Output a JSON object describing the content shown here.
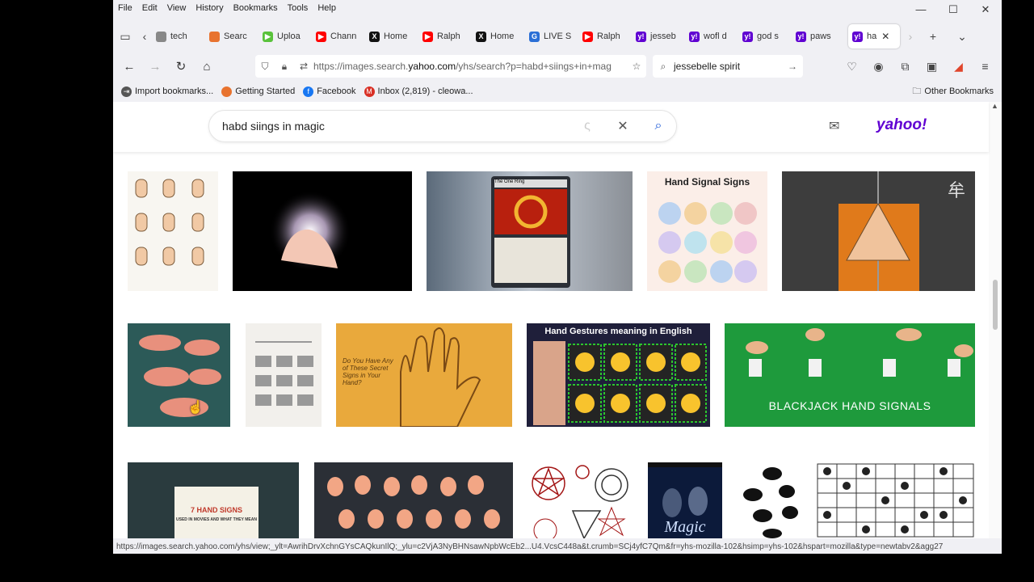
{
  "menubar": {
    "items": [
      "File",
      "Edit",
      "View",
      "History",
      "Bookmarks",
      "Tools",
      "Help"
    ]
  },
  "window_controls": {
    "minimize": "—",
    "maximize": "☐",
    "close": "✕"
  },
  "tabs": [
    {
      "label": "tech",
      "fav": "",
      "color": "#888888"
    },
    {
      "label": "Searc",
      "fav": "",
      "color": "#e8732f"
    },
    {
      "label": "Uploa",
      "fav": "▶",
      "color": "#59c23b"
    },
    {
      "label": "Chann",
      "fav": "▶",
      "color": "#ff0000"
    },
    {
      "label": "Home",
      "fav": "X",
      "color": "#111111"
    },
    {
      "label": "Ralph",
      "fav": "▶",
      "color": "#ff0000"
    },
    {
      "label": "Home",
      "fav": "X",
      "color": "#111111"
    },
    {
      "label": "LIVE S",
      "fav": "G",
      "color": "#2b6fd6"
    },
    {
      "label": "Ralph",
      "fav": "▶",
      "color": "#ff0000"
    },
    {
      "label": "jesseb",
      "fav": "y!",
      "color": "#6001d2"
    },
    {
      "label": "wofl d",
      "fav": "y!",
      "color": "#6001d2"
    },
    {
      "label": "god s",
      "fav": "y!",
      "color": "#6001d2"
    },
    {
      "label": "paws",
      "fav": "y!",
      "color": "#6001d2"
    }
  ],
  "active_tab": {
    "label": "ha",
    "fav": "y!",
    "color": "#6001d2"
  },
  "nav": {
    "url_prefix": "https://images.search.",
    "url_domain": "yahoo.com",
    "url_rest": "/yhs/search?p=habd+siings+in+mag",
    "search_value": "jessebelle spirit"
  },
  "bookmarks": [
    {
      "label": "Import bookmarks...",
      "color": "#555555",
      "fav": "⇥"
    },
    {
      "label": "Getting Started",
      "color": "#e8732f",
      "fav": ""
    },
    {
      "label": "Facebook",
      "color": "#1877f2",
      "fav": "f"
    },
    {
      "label": "Inbox (2,819) - cleowa...",
      "color": "#d93025",
      "fav": "M"
    }
  ],
  "other_bookmarks": "Other Bookmarks",
  "page": {
    "query": "habd siings in magic",
    "brand": "yahoo!",
    "brand_color": "#6001d2"
  },
  "images": {
    "hand_signal_title": "Hand Signal Signs",
    "gestures_title": "Hand Gestures meaning in English",
    "blackjack_title": "BLACKJACK HAND SIGNALS",
    "secret_signs": "Do You Have Any of These Secret Signs in Your Hand?",
    "seven_signs": "7 HAND SIGNS",
    "seven_signs_sub": "USED IN MOVIES AND WHAT THEY MEAN",
    "magic_word": "Magic",
    "card_title": "The One Ring"
  },
  "status_url": "https://images.search.yahoo.com/yhs/view;_ylt=AwrihDrvXchnGYsCAQkunIlQ;_ylu=c2VjA3NyBHNsawNpbWcEb2...U4.VcsC448a&t.crumb=SCj4yfC7Qm&fr=yhs-mozilla-102&hsimp=yhs-102&hspart=mozilla&type=newtabv2&agg27"
}
